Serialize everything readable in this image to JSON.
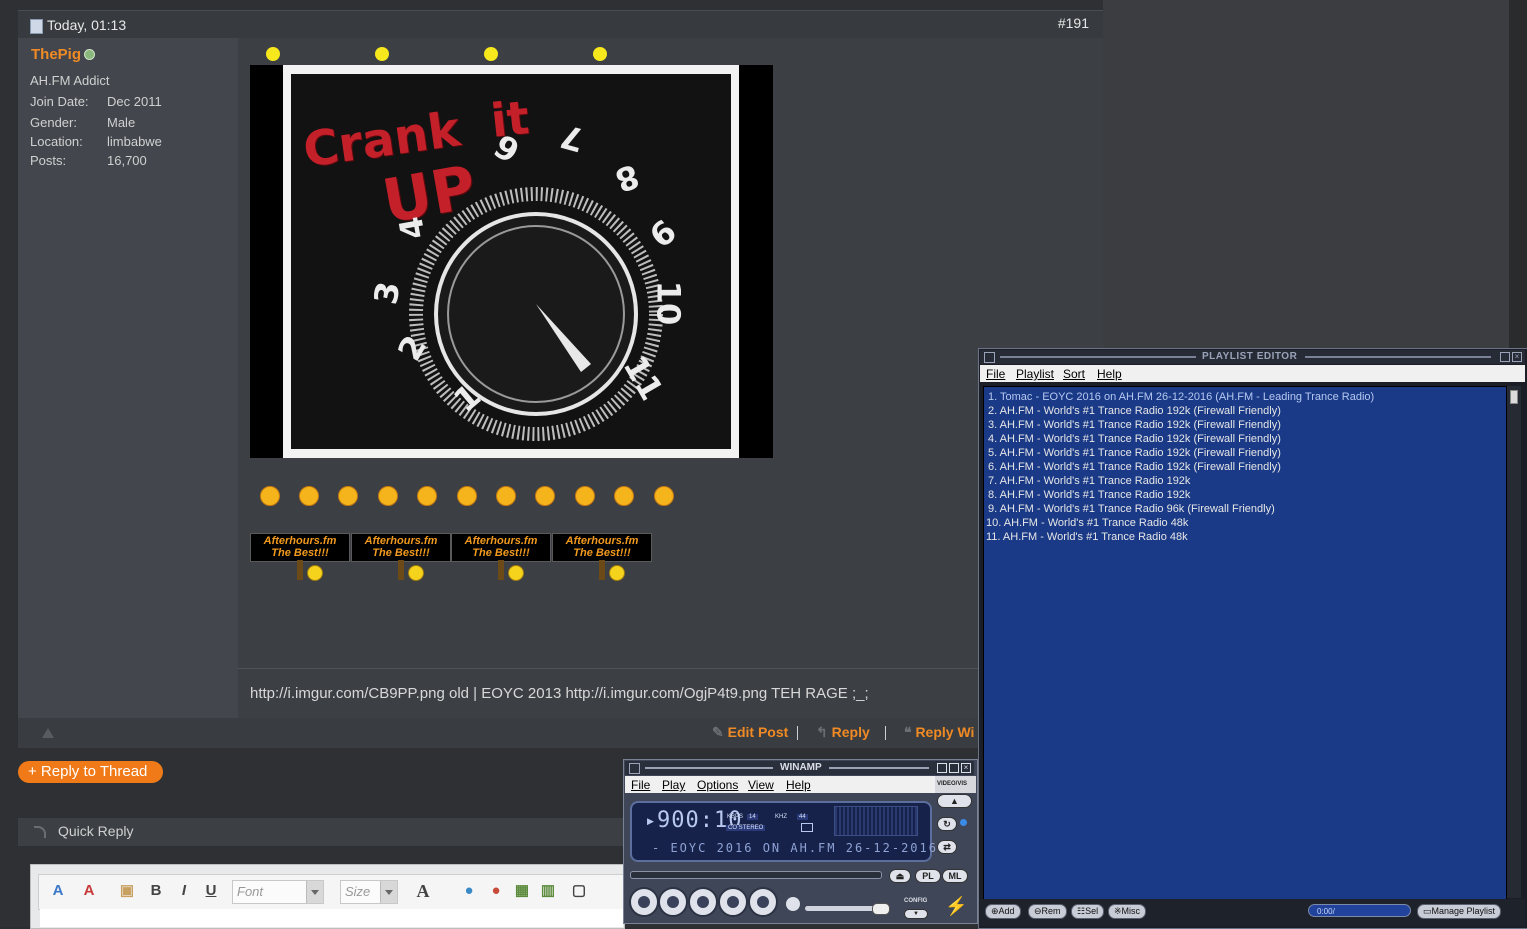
{
  "post": {
    "date": "Today, 01:13",
    "number": "#191",
    "username": "ThePig",
    "user_title": "AH.FM Addict",
    "info": [
      {
        "label": "Join Date:",
        "value": "Dec 2011"
      },
      {
        "label": "Gender:",
        "value": "Male"
      },
      {
        "label": "Location:",
        "value": "limbabwe"
      },
      {
        "label": "Posts:",
        "value": "16,700"
      }
    ],
    "image_text": {
      "line1": "Crank",
      "line2": "it",
      "line3": "UP"
    },
    "dial_numbers": [
      "1",
      "2",
      "3",
      "4",
      "5",
      "6",
      "7",
      "8",
      "9",
      "10",
      "11"
    ],
    "sign_line1": "Afterhours.fm",
    "sign_line2": "The Best!!!",
    "signature": "http://i.imgur.com/CB9PP.png old | EOYC 2013 http://i.imgur.com/OgjP4t9.png TEH RAGE ;_;",
    "actions": {
      "edit": "Edit Post",
      "reply": "Reply",
      "reply_with_quote": "Reply Wi"
    }
  },
  "thread": {
    "reply_to_thread": "+ Reply to Thread",
    "quick_reply": "Quick Reply",
    "editor": {
      "font": "Font",
      "size": "Size",
      "bold": "B",
      "italic": "I",
      "underline": "U",
      "text_color": "A"
    }
  },
  "playlist": {
    "title": "PLAYLIST EDITOR",
    "menu": [
      "File",
      "Playlist",
      "Sort",
      "Help"
    ],
    "items": [
      "1. Tomac - EOYC 2016 on AH.FM 26-12-2016 (AH.FM - Leading Trance Radio)",
      "2. AH.FM - World's #1 Trance Radio 192k (Firewall Friendly)",
      "3. AH.FM - World's #1 Trance Radio 192k (Firewall Friendly)",
      "4. AH.FM - World's #1 Trance Radio 192k (Firewall Friendly)",
      "5. AH.FM - World's #1 Trance Radio 192k (Firewall Friendly)",
      "6. AH.FM - World's #1 Trance Radio 192k (Firewall Friendly)",
      "7. AH.FM - World's #1 Trance Radio 192k",
      "8. AH.FM - World's #1 Trance Radio 192k",
      "9. AH.FM - World's #1 Trance Radio 96k (Firewall Friendly)",
      "10. AH.FM - World's #1 Trance Radio 48k",
      "11. AH.FM - World's #1 Trance Radio 48k"
    ],
    "buttons": {
      "add": "Add",
      "rem": "Rem",
      "sel": "Sel",
      "misc": "Misc",
      "manage": "Manage Playlist"
    },
    "time": "0:00/"
  },
  "winamp": {
    "title": "WINAMP",
    "menu": [
      "File",
      "Play",
      "Options",
      "View",
      "Help"
    ],
    "time": "900:10",
    "kbps_label": "KBPS",
    "kbps": "14",
    "khz_label": "KHZ",
    "khz": "44",
    "stereo": "CO STEREO",
    "scroll_text": "- EOYC 2016 ON AH.FM 26-12-2016",
    "video_vis": "VIDEO/VIS",
    "pl": "PL",
    "ml": "ML",
    "config": "CONFIG"
  },
  "colors": {
    "accent": "#f08a24",
    "playlist_bg": "#1a3a87",
    "forum_bg": "#3c3f44"
  }
}
